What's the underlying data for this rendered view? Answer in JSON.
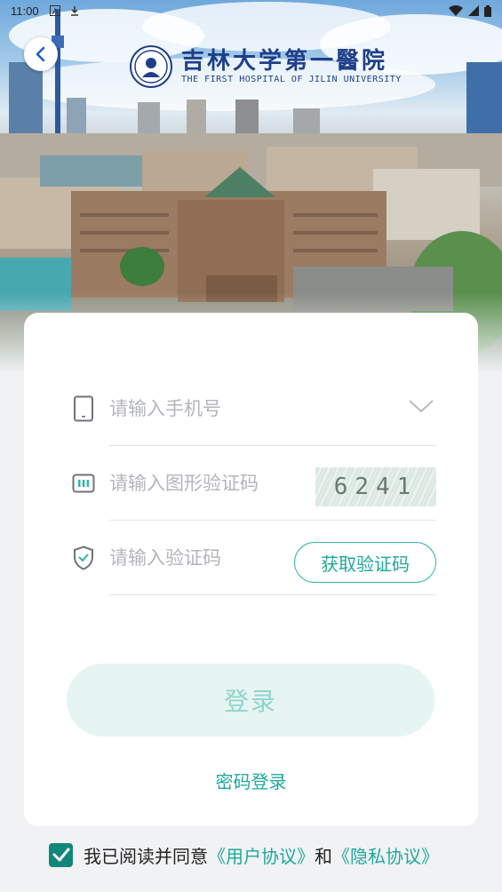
{
  "status_bar": {
    "time": "11:00",
    "left_icons": [
      "a-notification-icon",
      "download-icon"
    ],
    "right_icons": [
      "wifi-icon",
      "signal-icon",
      "battery-icon"
    ]
  },
  "header": {
    "back_icon": "chevron-left-icon",
    "logo": {
      "name_cn": "吉林大学第一醫院",
      "name_en": "THE FIRST HOSPITAL OF JILIN UNIVERSITY"
    }
  },
  "form": {
    "phone": {
      "placeholder": "请输入手机号",
      "icon": "phone-icon",
      "dropdown_icon": "chevron-down-icon"
    },
    "captcha": {
      "placeholder": "请输入图形验证码",
      "icon": "captcha-icon",
      "image_text": "6241"
    },
    "sms": {
      "placeholder": "请输入验证码",
      "icon": "shield-check-icon",
      "button_label": "获取验证码"
    },
    "login_label": "登录",
    "password_login_label": "密码登录"
  },
  "agreement": {
    "checked": true,
    "prefix": "我已阅读并同意",
    "user_agreement": "《用户协议》",
    "conjunction": "和",
    "privacy_agreement": "《隐私协议》"
  },
  "colors": {
    "accent": "#1ea89a",
    "checkbox": "#11877a",
    "login_bg": "#e6f4f2",
    "login_text": "#8fd4cb",
    "logo_blue": "#1f3f8a"
  }
}
